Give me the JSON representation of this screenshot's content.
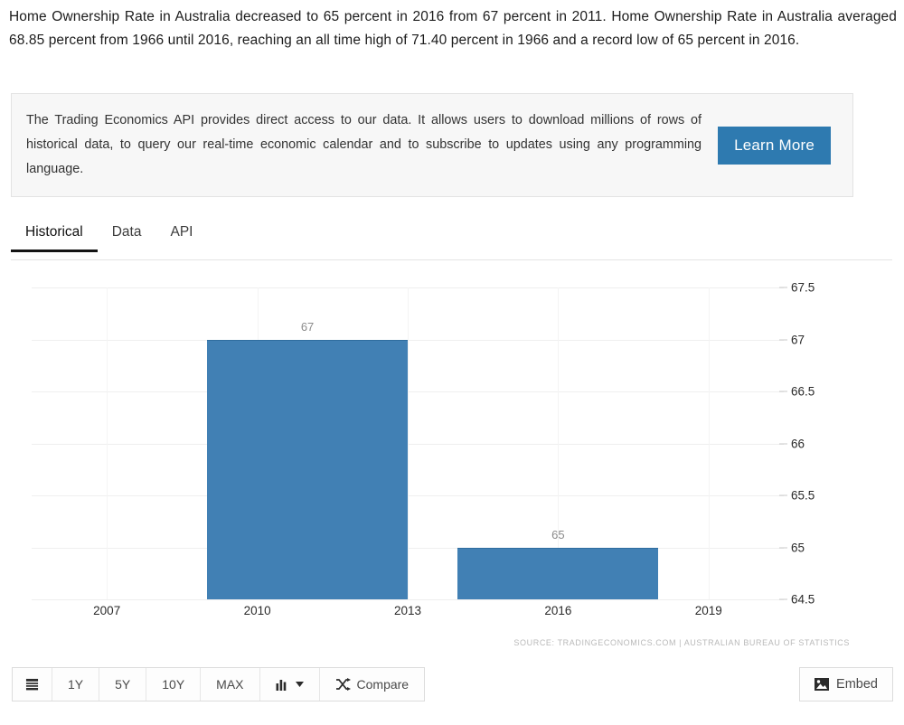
{
  "intro": {
    "paragraph": "Home Ownership Rate in Australia decreased to 65 percent in 2016 from 67 percent in 2011. Home Ownership Rate in Australia averaged 68.85 percent from 1966 until 2016, reaching an all time high of 71.40 percent in 1966 and a record low of 65 percent in 2016."
  },
  "promo": {
    "text": "The Trading Economics API provides direct access to our data. It allows users to download millions of rows of historical data, to query our real-time economic calendar and to subscribe to updates using any programming language.",
    "button_label": "Learn More",
    "button_color": "#2e7ab0"
  },
  "tabs": {
    "items": [
      {
        "label": "Historical",
        "active": true
      },
      {
        "label": "Data",
        "active": false
      },
      {
        "label": "API",
        "active": false
      }
    ]
  },
  "chart_data": {
    "type": "bar",
    "title": "",
    "subtitle": "",
    "xlabel": "",
    "ylabel": "",
    "categories": [
      "2011",
      "2016"
    ],
    "values": [
      67,
      65
    ],
    "data_labels": [
      "67",
      "65"
    ],
    "bar_color": "#4180b4",
    "ylim": [
      64.5,
      67.5
    ],
    "ytick_labels": [
      "67.5",
      "67",
      "66.5",
      "66",
      "65.5",
      "65",
      "64.5"
    ],
    "ytick_values": [
      67.5,
      67,
      66.5,
      66,
      65.5,
      65,
      64.5
    ],
    "xtick_labels": [
      "2007",
      "2010",
      "2013",
      "2016",
      "2019"
    ],
    "xtick_values": [
      2007,
      2010,
      2013,
      2016,
      2019
    ],
    "xlim": [
      2005.5,
      2020.5
    ],
    "grid": true,
    "legend": "none",
    "axis_position": "right",
    "source_note": "SOURCE: TRADINGECONOMICS.COM | AUSTRALIAN BUREAU OF STATISTICS"
  },
  "toolbar": {
    "buttons": [
      {
        "label": "",
        "icon": "calendar-icon",
        "name": "calendar-button"
      },
      {
        "label": "1Y",
        "icon": "",
        "name": "range-1y-button"
      },
      {
        "label": "5Y",
        "icon": "",
        "name": "range-5y-button"
      },
      {
        "label": "10Y",
        "icon": "",
        "name": "range-10y-button"
      },
      {
        "label": "MAX",
        "icon": "",
        "name": "range-max-button"
      },
      {
        "label": "",
        "icon": "bar-chart-dropdown-icon",
        "name": "chart-type-dropdown"
      },
      {
        "label": "Compare",
        "icon": "shuffle-icon",
        "name": "compare-button"
      }
    ],
    "embed_label": "Embed"
  }
}
